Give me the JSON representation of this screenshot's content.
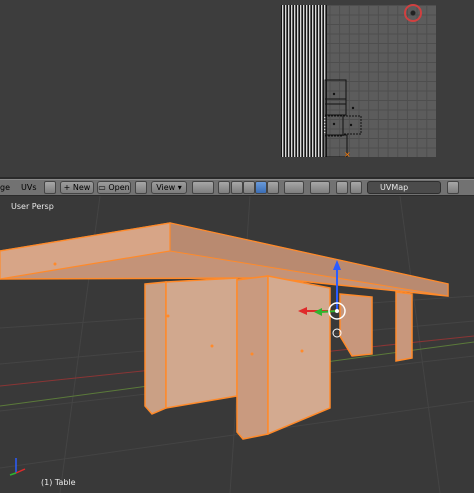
{
  "uv_editor": {
    "name": "UV/Image Editor"
  },
  "header": {
    "partial_label": "ge",
    "uvs_menu": "UVs",
    "new_button": "New",
    "open_button": "Open",
    "view_select": "View",
    "uvmap_field": "UVMap"
  },
  "viewport": {
    "view_name": "User Persp",
    "object_label": "(1) Table"
  },
  "colors": {
    "selection": "#ff8a2a",
    "face_fill": "#d9a384",
    "background": "#393939"
  }
}
